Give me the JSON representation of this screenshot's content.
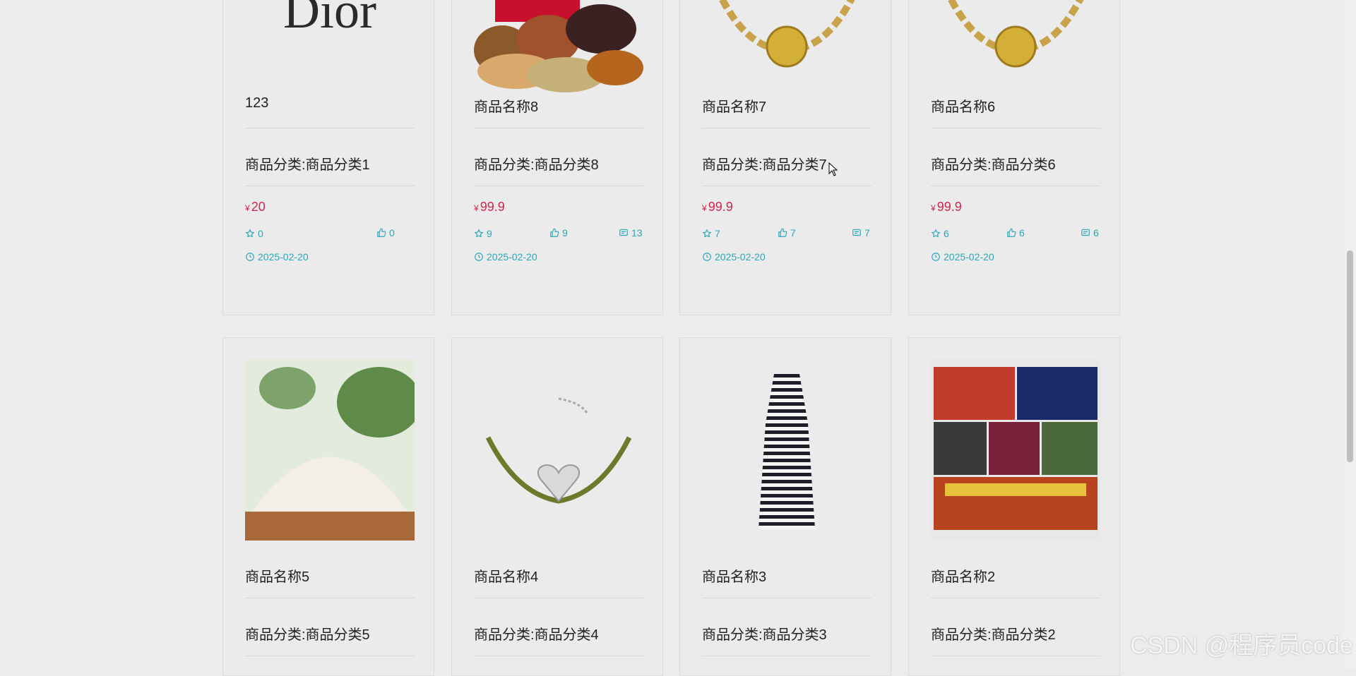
{
  "products": [
    {
      "name": "123",
      "category": "商品分类:商品分类1",
      "price": "20",
      "favorites": "0",
      "likes": "0",
      "comments": "",
      "date": "2025-02-20",
      "image": "dior-logo"
    },
    {
      "name": "商品名称8",
      "category": "商品分类:商品分类8",
      "price": "99.9",
      "favorites": "9",
      "likes": "9",
      "comments": "13",
      "date": "2025-02-20",
      "image": "nuts-image"
    },
    {
      "name": "商品名称7",
      "category": "商品分类:商品分类7",
      "price": "99.9",
      "favorites": "7",
      "likes": "7",
      "comments": "7",
      "date": "2025-02-20",
      "image": "gold-bracelet-image"
    },
    {
      "name": "商品名称6",
      "category": "商品分类:商品分类6",
      "price": "99.9",
      "favorites": "6",
      "likes": "6",
      "comments": "6",
      "date": "2025-02-20",
      "image": "gold-bracelet-image"
    },
    {
      "name": "商品名称5",
      "category": "商品分类:商品分类5",
      "image": "flour-image"
    },
    {
      "name": "商品名称4",
      "category": "商品分类:商品分类4",
      "image": "silver-bracelet-image"
    },
    {
      "name": "商品名称3",
      "category": "商品分类:商品分类3",
      "image": "striped-dress-image"
    },
    {
      "name": "商品名称2",
      "category": "商品分类:商品分类2",
      "image": "street-collage-image"
    }
  ],
  "currency_symbol": "¥",
  "dior_text": "Dior",
  "watermark": "CSDN @程序员code",
  "colors": {
    "price": "#d0264f",
    "meta": "#2aa7b8",
    "background": "#ececec"
  }
}
